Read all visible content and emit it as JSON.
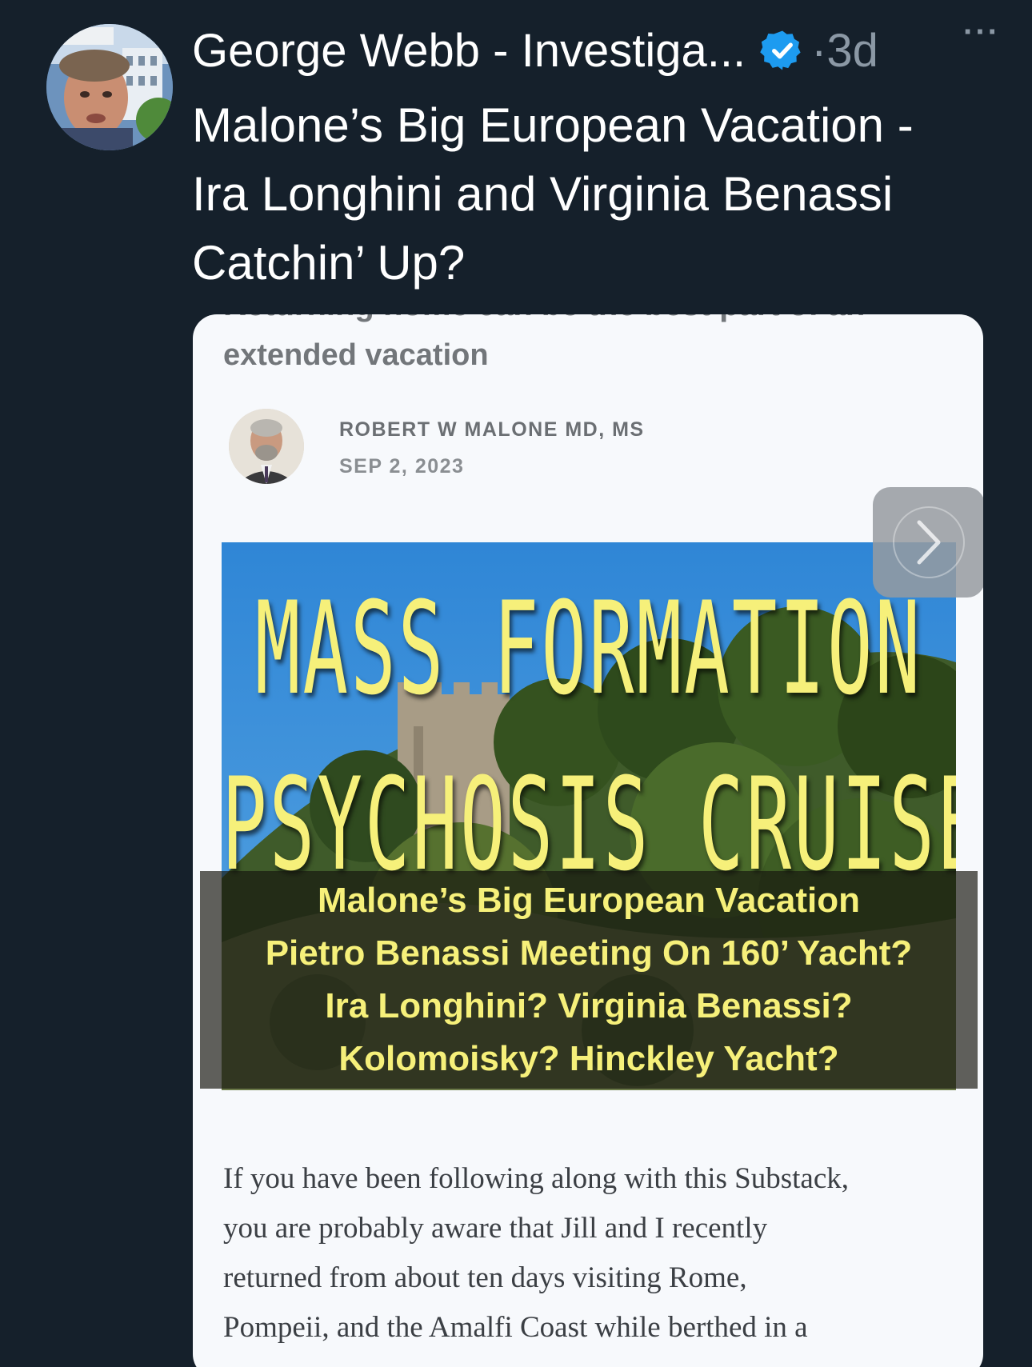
{
  "tweet": {
    "author_name": "George Webb - Investiga...",
    "separator": "·",
    "time": "3d",
    "more_label": "···",
    "text_lines": [
      "Malone’s Big European Vacation -",
      "Ira Longhini and Virginia Benassi",
      "Catchin’ Up?"
    ]
  },
  "card": {
    "cut_title": "Returning home can be the best part of an",
    "subtitle": "extended vacation",
    "author_label": "ROBERT W MALONE MD, MS",
    "date": "SEP 2, 2023",
    "banner": {
      "headline_1": "MASS FORMATION",
      "headline_2": "PSYCHOSIS CRUISE?",
      "overlay_lines": [
        "Malone’s Big European Vacation",
        "Pietro Benassi Meeting On 160’ Yacht?",
        "Ira Longhini?  Virginia Benassi?",
        "Kolomoisky? Hinckley Yacht?"
      ]
    },
    "body_lines": [
      "If you have been following along with this Substack,",
      "you are probably aware that Jill and I recently",
      "returned from about ten days visiting Rome,",
      "Pompeii, and the Amalfi Coast while berthed in a"
    ]
  },
  "icons": {
    "verified": "verified-badge-icon",
    "next": "chevron-right-icon",
    "more": "more-options-icon"
  },
  "colors": {
    "background": "#15202b",
    "verified_blue": "#1d9bf0",
    "headline_yellow": "#f6f07a",
    "secondary_text": "#8b98a5",
    "card_background": "#f7f9fc"
  }
}
